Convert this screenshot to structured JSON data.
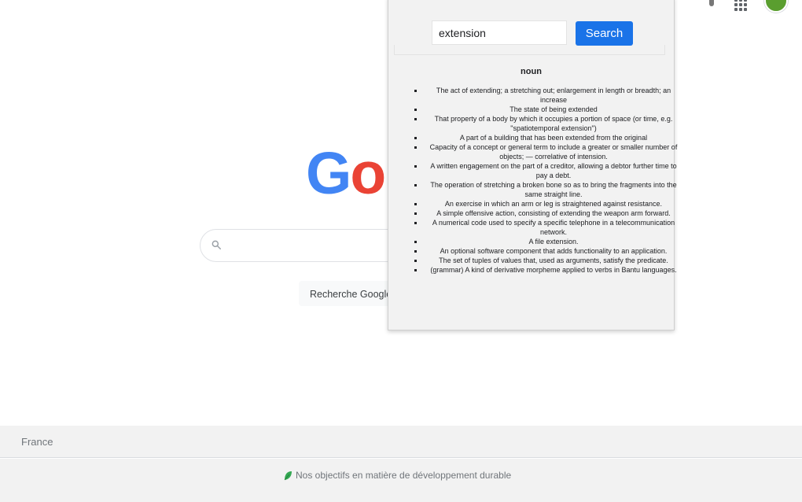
{
  "google": {
    "logo_visible": "Go",
    "search_button_label": "Recherche Google",
    "footer_country": "France",
    "footer_sustainability": "Nos objectifs en matière de développement durable"
  },
  "popup": {
    "search_value": "extension",
    "search_button": "Search",
    "part_of_speech": "noun",
    "definitions": [
      "The act of extending; a stretching out; enlargement in length or breadth; an increase",
      "The state of being extended",
      "That property of a body by which it occupies a portion of space (or time, e.g. \"spatiotemporal extension\")",
      "A part of a building that has been extended from the original",
      "Capacity of a concept or general term to include a greater or smaller number of objects; — correlative of intension.",
      "A written engagement on the part of a creditor, allowing a debtor further time to pay a debt.",
      "The operation of stretching a broken bone so as to bring the fragments into the same straight line.",
      "An exercise in which an arm or leg is straightened against resistance.",
      "A simple offensive action, consisting of extending the weapon arm forward.",
      "A numerical code used to specify a specific telephone in a telecommunication network.",
      "A file extension.",
      "An optional software component that adds functionality to an application.",
      "The set of tuples of values that, used as arguments, satisfy the predicate.",
      "(grammar) A kind of derivative morpheme applied to verbs in Bantu languages."
    ]
  },
  "icons": {
    "search": "search-icon",
    "apps": "apps-grid-icon",
    "leaf": "leaf-icon",
    "avatar": "avatar"
  },
  "colors": {
    "accent": "#1a73e8",
    "google_blue": "#4285f4",
    "google_red": "#ea4335",
    "avatar_green": "#5a9e2f"
  }
}
